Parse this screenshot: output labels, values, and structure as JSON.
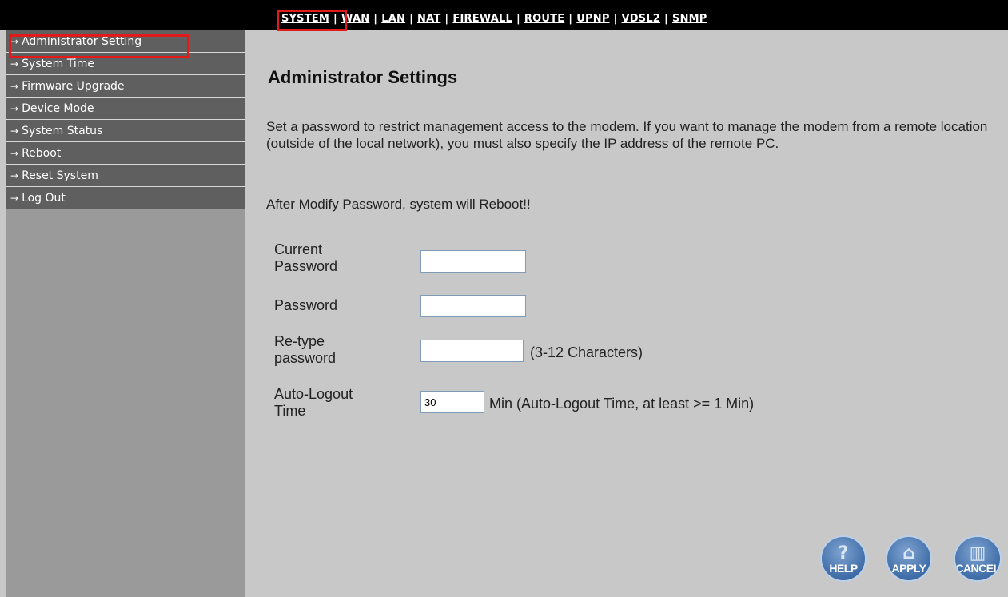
{
  "topnav": {
    "items": [
      "SYSTEM",
      "WAN",
      "LAN",
      "NAT",
      "FIREWALL",
      "ROUTE",
      "UPNP",
      "VDSL2",
      "SNMP"
    ],
    "separator": "|"
  },
  "sidebar": {
    "items": [
      {
        "label": "Administrator Setting"
      },
      {
        "label": "System Time"
      },
      {
        "label": "Firmware Upgrade"
      },
      {
        "label": "Device Mode"
      },
      {
        "label": "System Status"
      },
      {
        "label": "Reboot"
      },
      {
        "label": "Reset System"
      },
      {
        "label": "Log Out"
      }
    ],
    "arrow": "→"
  },
  "main": {
    "title": "Administrator Settings",
    "description": "Set a password to restrict management access to the modem. If you want to manage the modem from a remote location (outside of the local network), you must also specify the IP address of the remote PC.",
    "warning": "After Modify Password, system will Reboot!!",
    "form": {
      "current_password_label_1": "Current",
      "current_password_label_2": "Password",
      "current_password_value": "",
      "password_label": "Password",
      "password_value": "",
      "retype_label_1": "Re-type",
      "retype_label_2": "password",
      "retype_value": "",
      "retype_hint": "(3-12 Characters)",
      "logout_label_1": "Auto-Logout",
      "logout_label_2": "Time",
      "logout_value": "30",
      "logout_hint": "Min (Auto-Logout Time, at least >= 1 Min)"
    }
  },
  "buttons": {
    "help": "HELP",
    "apply": "APPLY",
    "cancel": "CANCEL"
  }
}
